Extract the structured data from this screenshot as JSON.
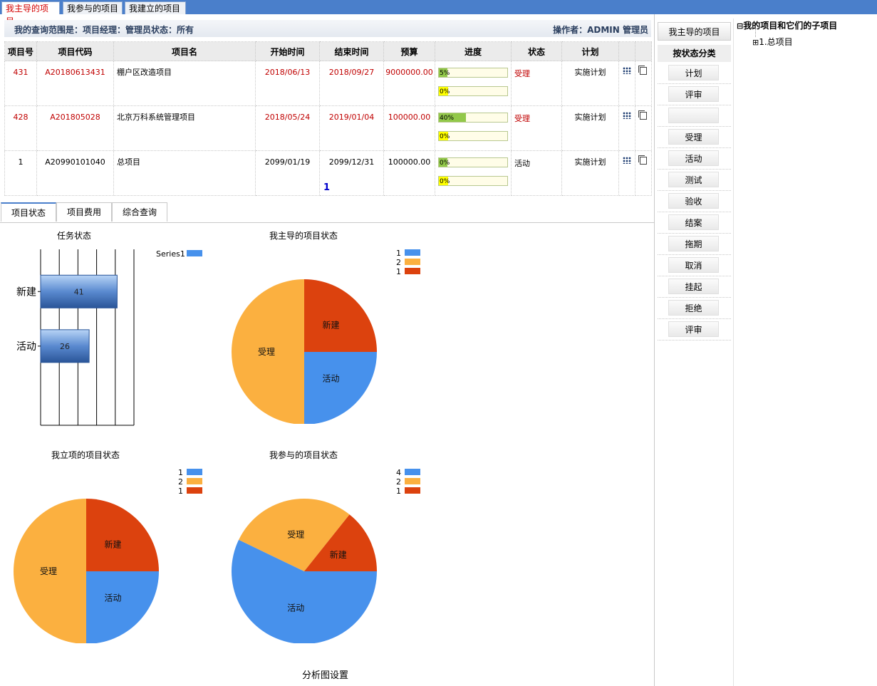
{
  "top_tabs": [
    {
      "label": "我主导的项目",
      "active": true
    },
    {
      "label": "我参与的项目",
      "active": false
    },
    {
      "label": "我建立的项目",
      "active": false
    }
  ],
  "info": {
    "scope": "我的查询范围是：项目经理：管理员状态：所有",
    "operator": "操作者：ADMIN 管理员"
  },
  "table": {
    "headers": [
      "项目号",
      "项目代码",
      "项目名",
      "开始时间",
      "结束时间",
      "预算",
      "进度",
      "状态",
      "计划"
    ],
    "rows": [
      {
        "id": "431",
        "code": "A20180613431",
        "name": "棚户区改造项目",
        "start": "2018/06/13",
        "end": "2018/09/27",
        "budget": "9000000.00",
        "progress1": "5%",
        "progress1_value": 0.05,
        "progress2": "0%",
        "progress2_value": 0.0,
        "status": "受理",
        "plan": "实施计划",
        "highlight": true
      },
      {
        "id": "428",
        "code": "A201805028",
        "name": "北京万科系统管理项目",
        "start": "2018/05/24",
        "end": "2019/01/04",
        "budget": "100000.00",
        "progress1": "40%",
        "progress1_value": 0.4,
        "progress2": "0%",
        "progress2_value": 0.0,
        "status": "受理",
        "plan": "实施计划",
        "highlight": true
      },
      {
        "id": "1",
        "code": "A20990101040",
        "name": "总项目",
        "start": "2099/01/19",
        "end": "2099/12/31",
        "budget": "100000.00",
        "progress1": "0%",
        "progress1_value": 0.0,
        "progress2": "0%",
        "progress2_value": 0.0,
        "status": "活动",
        "plan": "实施计划",
        "highlight": false
      }
    ]
  },
  "pager": {
    "current": "1"
  },
  "lower_tabs": [
    {
      "label": "项目状态",
      "active": true
    },
    {
      "label": "项目费用",
      "active": false
    },
    {
      "label": "综合查询",
      "active": false
    }
  ],
  "colors": {
    "blue": "#4791ec",
    "orange": "#fbb040",
    "red": "#dc420e",
    "bar": "#5a8ad0"
  },
  "chart_data": [
    {
      "type": "bar",
      "title": "任务状态",
      "orientation": "horizontal",
      "categories": [
        "新建",
        "活动"
      ],
      "series": [
        {
          "name": "Series1",
          "values": [
            41,
            26
          ]
        }
      ],
      "xlim": [
        0,
        50
      ],
      "xticks": [
        "0",
        "10",
        "20",
        "30",
        "40",
        "50"
      ],
      "legend": "top-right"
    },
    {
      "type": "pie",
      "title": "我主导的项目状态",
      "labels": [
        "活动",
        "受理",
        "新建"
      ],
      "values": [
        1,
        2,
        1
      ],
      "legend": [
        "1",
        "2",
        "1"
      ]
    },
    {
      "type": "pie",
      "title": "我立项的项目状态",
      "labels": [
        "活动",
        "受理",
        "新建"
      ],
      "values": [
        1,
        2,
        1
      ],
      "legend": [
        "1",
        "2",
        "1"
      ]
    },
    {
      "type": "pie",
      "title": "我参与的项目状态",
      "labels": [
        "活动",
        "受理",
        "新建"
      ],
      "values": [
        4,
        2,
        1
      ],
      "legend": [
        "4",
        "2",
        "1"
      ]
    }
  ],
  "analysis_label": "分析图设置",
  "status_panel": {
    "header": "我主导的项目",
    "category_title": "按状态分类",
    "buttons": [
      "计划",
      "评审",
      "",
      "受理",
      "活动",
      "测试",
      "验收",
      "结案",
      "拖期",
      "取消",
      "挂起",
      "拒绝",
      "评审"
    ]
  },
  "tree": {
    "root": "我的项目和它们的子项目",
    "child": "1.总项目",
    "expander": "⊟",
    "child_expander": "⊞"
  }
}
